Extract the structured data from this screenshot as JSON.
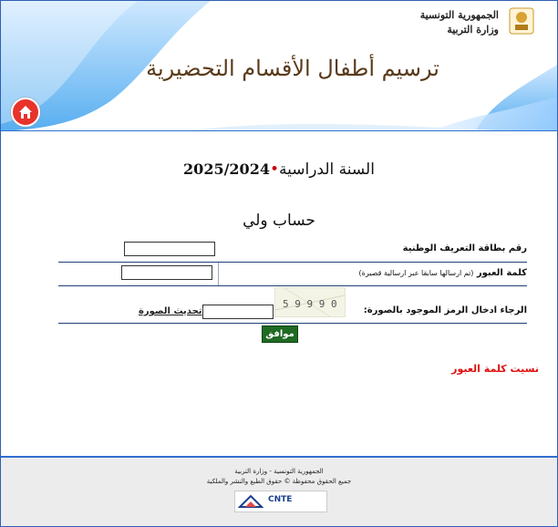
{
  "header": {
    "ministry_line1": "الجمهورية التونسية",
    "ministry_line2": "وزارة التربية",
    "title": "ترسيم أطفال الأقسام التحضيرية",
    "home_icon": "home-icon",
    "emblem_icon": "ministry-emblem-icon"
  },
  "main": {
    "year_label": "السنة الدراسية",
    "year_value": "2025/2024",
    "account_title": "حساب ولي",
    "fields": {
      "national_id_label": "رقم بطاقة التعريف الوطنية",
      "national_id_value": "",
      "password_label": "كلمة العبور",
      "password_note": "(تم ارسالها سابقا عبر ارسالية قصيرة)",
      "password_value": "",
      "captcha_label": "الرجاء ادخال الرمز الموجود بالصورة:",
      "captcha_code": "5 9 9 9 0",
      "captcha_value": "",
      "refresh_label": "تحديث الصورة"
    },
    "submit_label": "موافق",
    "forgot_label": "نسيت كلمة العبور"
  },
  "footer": {
    "line1": "الجمهورية التونسية - وزارة التربية",
    "line2": "جميع الحقوق محفوظة © حقوق الطبع والنشر والملكية",
    "logo_text": "CNTE"
  },
  "colors": {
    "accent_blue": "#2f6fd0",
    "title_brown": "#5a3a1a",
    "submit_green": "#1f6a24",
    "link_red": "#e01010"
  }
}
